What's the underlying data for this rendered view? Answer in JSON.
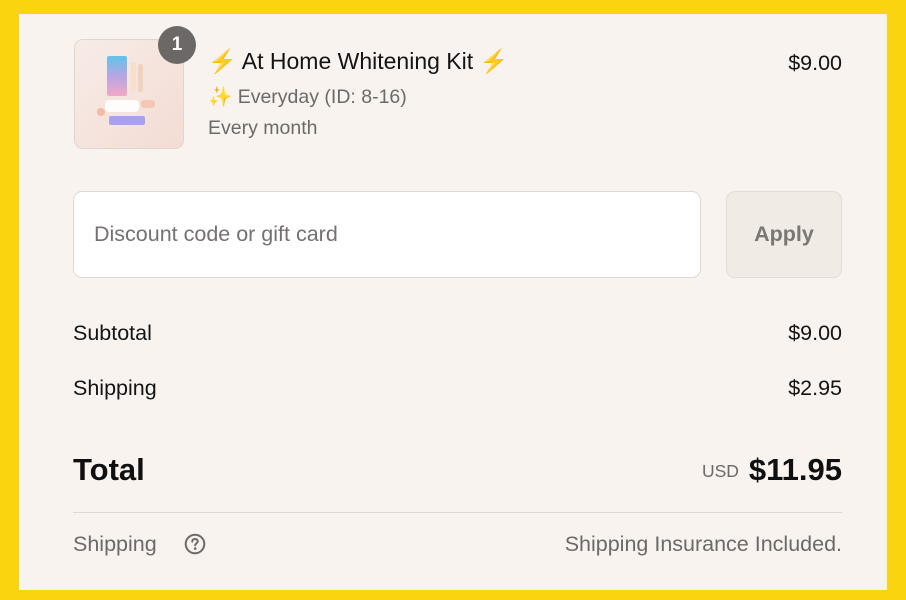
{
  "product": {
    "title": "At Home Whitening Kit",
    "title_icon": "lightning-bolt",
    "variant": "Everyday (ID: 8-16)",
    "variant_icon": "sparkles",
    "interval": "Every month",
    "price": "$9.00",
    "quantity": "1"
  },
  "discount": {
    "placeholder": "Discount code or gift card",
    "value": "",
    "apply_label": "Apply"
  },
  "summary": {
    "subtotal_label": "Subtotal",
    "subtotal_value": "$9.00",
    "shipping_label": "Shipping",
    "shipping_value": "$2.95",
    "total_label": "Total",
    "currency": "USD",
    "total_value": "$11.95"
  },
  "footer": {
    "shipping_label": "Shipping",
    "shipping_note": "Shipping Insurance Included."
  },
  "colors": {
    "frame": "#f9d40f",
    "panel": "#f8f3ef",
    "bolt": "#f4b81f"
  }
}
